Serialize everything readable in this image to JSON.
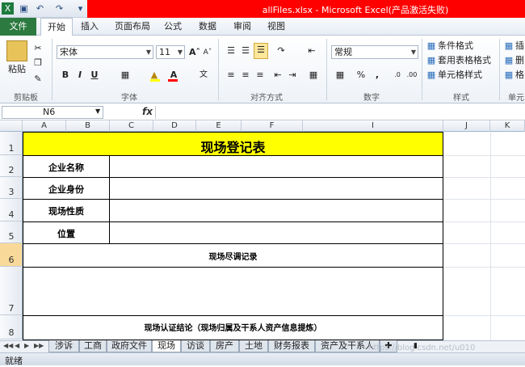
{
  "window": {
    "title": "allFiles.xlsx - Microsoft Excel(产品激活失败)"
  },
  "menu": {
    "file": "文件",
    "tabs": [
      "开始",
      "插入",
      "页面布局",
      "公式",
      "数据",
      "审阅",
      "视图"
    ]
  },
  "ribbon": {
    "clipboard": {
      "paste": "粘贴",
      "group": "剪贴板"
    },
    "font": {
      "name": "宋体",
      "size": "11",
      "bold": "B",
      "italic": "I",
      "underline": "U",
      "group": "字体"
    },
    "alignment": {
      "group": "对齐方式"
    },
    "number": {
      "format": "常规",
      "percent": "%",
      "comma": ",",
      "group": "数字"
    },
    "styles": {
      "conditional": "条件格式",
      "table": "套用表格格式",
      "cell": "单元格样式",
      "group": "样式"
    },
    "cells": {
      "insert": "插",
      "delete": "删",
      "format": "格",
      "group": "单元"
    }
  },
  "formula": {
    "namebox": "N6",
    "fx": "fx",
    "content": ""
  },
  "columns": [
    "A",
    "B",
    "C",
    "D",
    "E",
    "F",
    "I",
    "J",
    "K"
  ],
  "rows": [
    "1",
    "2",
    "3",
    "4",
    "5",
    "6",
    "7",
    "8"
  ],
  "sheet": {
    "title": "现场登记表",
    "labels": [
      "企业名称",
      "企业身份",
      "现场性质",
      "位置"
    ],
    "survey": "现场尽调记录",
    "conclusion": "现场认证结论（现场归属及干系人资产信息提炼）"
  },
  "tabs": [
    "涉诉",
    "工商",
    "政府文件",
    "现场",
    "访谈",
    "房产",
    "土地",
    "财务报表",
    "资产及干系人"
  ],
  "active_tab": "现场",
  "status": "就绪",
  "watermark": "https://blog.csdn.net/u010"
}
